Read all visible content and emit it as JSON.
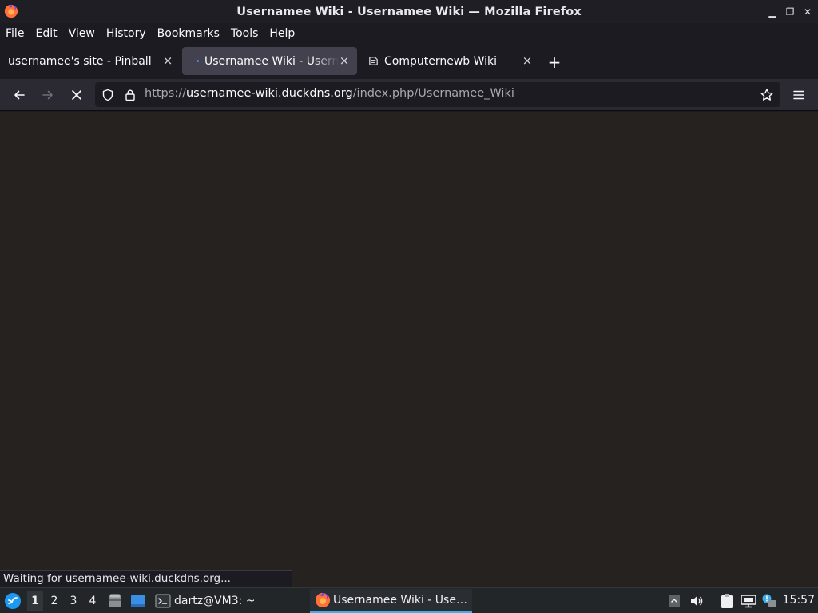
{
  "window": {
    "title": "Usernamee Wiki - Usernamee Wiki — Mozilla Firefox",
    "controls": {
      "minimize": "▁",
      "restore": "❐",
      "close": "✕"
    }
  },
  "menu": {
    "items": [
      {
        "accel": "F",
        "rest": "ile"
      },
      {
        "accel": "E",
        "rest": "dit"
      },
      {
        "accel": "V",
        "rest": "iew"
      },
      {
        "pre": "Hi",
        "accel": "s",
        "rest": "tory"
      },
      {
        "accel": "B",
        "rest": "ookmarks"
      },
      {
        "accel": "T",
        "rest": "ools"
      },
      {
        "accel": "H",
        "rest": "elp"
      }
    ]
  },
  "tabs": [
    {
      "label": "usernamee's site - Pinball",
      "close": "×"
    },
    {
      "label": "Usernamee Wiki - Usernamee Wiki",
      "close": "×"
    },
    {
      "label": "Computernewb Wiki",
      "close": "×"
    }
  ],
  "new_tab": "+",
  "url": {
    "scheme": "https://",
    "host": "usernamee-wiki.duckdns.org",
    "path": "/index.php/Usernamee_Wiki"
  },
  "status_text": "Waiting for usernamee-wiki.duckdns.org...",
  "taskbar": {
    "workspaces": [
      "1",
      "2",
      "3",
      "4"
    ],
    "terminal_task": "dartz@VM3: ~",
    "firefox_task": "Usernamee Wiki - Use…",
    "clock": "15:57"
  },
  "colors": {
    "accent": "#3daee9",
    "tab_active_bg": "#42414d",
    "content_bg": "#252220"
  }
}
